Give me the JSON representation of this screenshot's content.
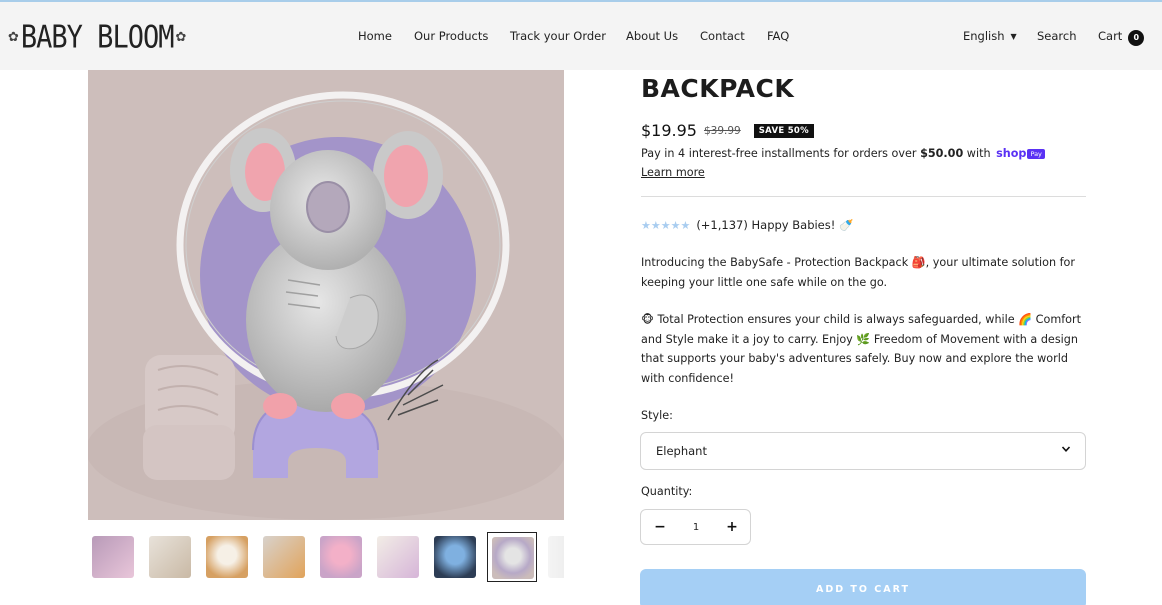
{
  "header": {
    "logo_text": "BABY BLOOM",
    "nav": [
      {
        "label": "Home"
      },
      {
        "label": "Our Products"
      },
      {
        "label": "Track your Order"
      },
      {
        "label": "About Us"
      },
      {
        "label": "Contact"
      },
      {
        "label": "FAQ"
      }
    ],
    "language": "English",
    "search_label": "Search",
    "cart_label": "Cart",
    "cart_count": "0"
  },
  "gallery": {
    "thumbnail_count": 9,
    "active_thumbnail": 8
  },
  "product": {
    "title": "BACKPACK",
    "price": "$19.95",
    "compare_price": "$39.99",
    "save_badge": "SAVE 50%",
    "installments_prefix": "Pay in 4 interest-free installments for orders over ",
    "installments_amount": "$50.00",
    "installments_with": " with ",
    "shop_pay_text": "shop",
    "shop_pay_pill": "Pay",
    "learn_more": "Learn more",
    "rating_stars": 5,
    "rating_text": "(+1,137) Happy Babies! 🍼",
    "description_1": "Introducing the BabySafe - Protection Backpack 🎒, your ultimate solution for keeping your little one safe while on the go.",
    "description_2": "🐵 Total Protection ensures your child is always safeguarded, while 🌈 Comfort and Style make it a joy to carry. Enjoy 🌿 Freedom of Movement with a design that supports your baby's adventures safely. Buy now and explore the world with confidence!",
    "style_label": "Style:",
    "style_value": "Elephant",
    "quantity_label": "Quantity:",
    "quantity_value": "1",
    "qty_minus": "−",
    "qty_plus": "+",
    "add_to_cart": "ADD TO CART"
  },
  "colors": {
    "accent": "#a5cff5",
    "star": "#a9cdf0",
    "shop_pay": "#5a31f4",
    "header_bg": "#f4f4f4"
  }
}
